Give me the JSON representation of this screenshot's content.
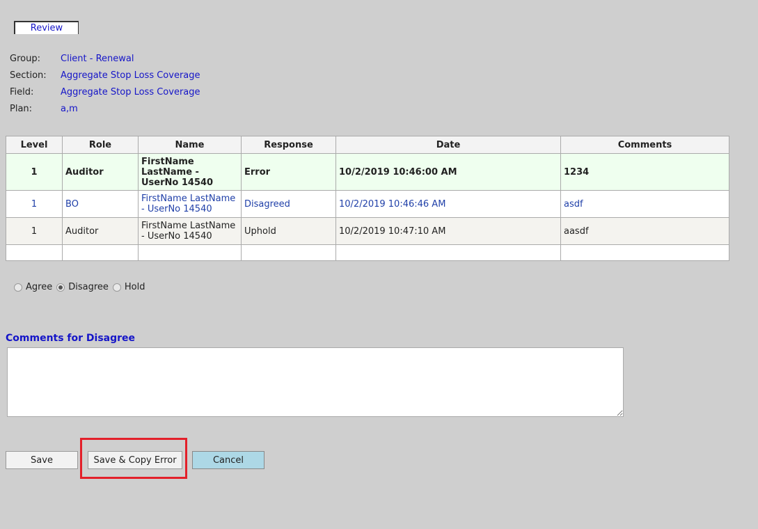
{
  "tab": {
    "label": "Review"
  },
  "info": [
    {
      "label": "Group:",
      "value": "Client - Renewal"
    },
    {
      "label": "Section:",
      "value": "Aggregate Stop Loss Coverage"
    },
    {
      "label": "Field:",
      "value": "Aggregate Stop Loss Coverage"
    },
    {
      "label": "Plan:",
      "value": "a,m"
    }
  ],
  "table": {
    "headers": [
      "Level",
      "Role",
      "Name",
      "Response",
      "Date",
      "Comments"
    ],
    "rows": [
      {
        "level": "1",
        "role": "Auditor",
        "name": "FirstName LastName - UserNo 14540",
        "response": "Error",
        "date": "10/2/2019 10:46:00 AM",
        "comments": "1234"
      },
      {
        "level": "1",
        "role": "BO",
        "name": "FirstName LastName - UserNo 14540",
        "response": "Disagreed",
        "date": "10/2/2019 10:46:46 AM",
        "comments": "asdf"
      },
      {
        "level": "1",
        "role": "Auditor",
        "name": "FirstName LastName - UserNo 14540",
        "response": "Uphold",
        "date": "10/2/2019 10:47:10 AM",
        "comments": "aasdf"
      }
    ]
  },
  "radios": [
    {
      "label": "Agree",
      "checked": false
    },
    {
      "label": "Disagree",
      "checked": true
    },
    {
      "label": "Hold",
      "checked": false
    }
  ],
  "comments": {
    "title": "Comments for Disagree",
    "value": ""
  },
  "buttons": {
    "save": "Save",
    "save_copy": "Save & Copy Error",
    "cancel": "Cancel"
  },
  "colors": {
    "highlight": "#e3202a",
    "cancel_bg": "#add8e6",
    "link": "#1515c8"
  }
}
